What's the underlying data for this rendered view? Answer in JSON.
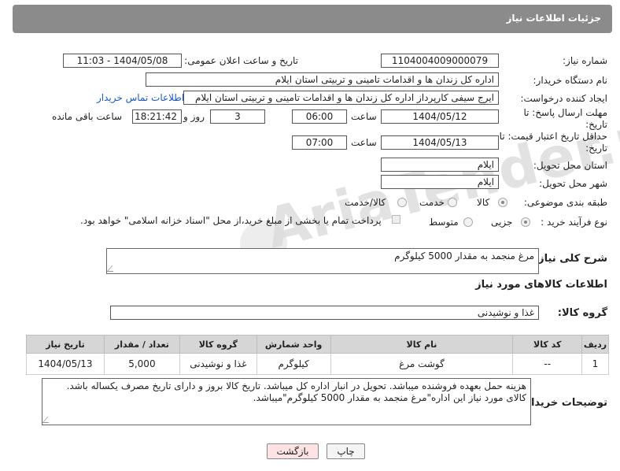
{
  "header": {
    "title": "جزئیات اطلاعات نیاز"
  },
  "form": {
    "need_number": {
      "label": "شماره نیاز:",
      "value": "1104004009000079"
    },
    "announce_datetime": {
      "label": "تاریخ و ساعت اعلان عمومی:",
      "value": "1404/05/08 - 11:03"
    },
    "buyer_org": {
      "label": "نام دستگاه خریدار:",
      "value": "اداره کل زندان ها و اقدامات تامینی و تربیتی استان ایلام"
    },
    "requester": {
      "label": "ایجاد کننده درخواست:",
      "value": "ایرج  سیفی کارپرداز اداره کل زندان ها و اقدامات تامینی و تربیتی استان ایلام",
      "contact_link": "اطلاعات تماس خریدار"
    },
    "reply_deadline": {
      "label": "مهلت ارسال پاسخ: تا تاریخ:",
      "date": "1404/05/12",
      "time_label": "ساعت",
      "time": "06:00",
      "days": "3",
      "days_label": "روز و",
      "remaining": "18:21:42",
      "remaining_label": "ساعت باقی مانده"
    },
    "price_validity": {
      "label": "حداقل تاریخ اعتبار قیمت: تا تاریخ:",
      "date": "1404/05/13",
      "time_label": "ساعت",
      "time": "07:00"
    },
    "delivery_province": {
      "label": "استان محل تحویل:",
      "value": "ایلام"
    },
    "delivery_city": {
      "label": "شهر محل تحویل:",
      "value": "ایلام"
    },
    "category": {
      "label": "طبقه بندی موضوعی:",
      "options": [
        "کالا",
        "خدمت",
        "کالا/خدمت"
      ]
    },
    "purchase_type": {
      "label": "نوع فرآیند خرید :",
      "options": [
        "جزیی",
        "متوسط"
      ],
      "note": "پرداخت تمام یا بخشی از مبلغ خرید،از محل \"اسناد خزانه اسلامی\" خواهد بود."
    }
  },
  "description": {
    "label": "شرح کلی نیاز:",
    "value": "مرغ منجمد به مقدار  5000 کیلوگرم"
  },
  "goods_section_title": "اطلاعات کالاهای مورد نیاز",
  "goods_group": {
    "label": "گروه کالا:",
    "value": "غذا و نوشیدنی"
  },
  "table": {
    "headers": [
      "ردیف",
      "کد کالا",
      "نام کالا",
      "واحد شمارش",
      "گروه کالا",
      "تعداد / مقدار",
      "تاریخ نیاز"
    ],
    "rows": [
      [
        "1",
        "--",
        "گوشت مرغ",
        "کیلوگرم",
        "غذا و نوشیدنی",
        "5,000",
        "1404/05/13"
      ]
    ]
  },
  "buyer_notes": {
    "label": "توضیحات خریدار:",
    "value": "هزینه حمل بعهده فروشنده میباشد. تحویل در انبار اداره کل میباشد. تاریخ کالا بروز و دارای تاریخ مصرف یکساله باشد. کالای مورد نیاز این اداره\"مرغ منجمد به مقدار  5000 کیلوگرم\"میباشد."
  },
  "buttons": {
    "print": "چاپ",
    "back": "بازگشت"
  },
  "colors": {
    "header_bg": "#8b8b8b",
    "link": "#1a57c7",
    "back_button_bg": "#fde3e3"
  }
}
